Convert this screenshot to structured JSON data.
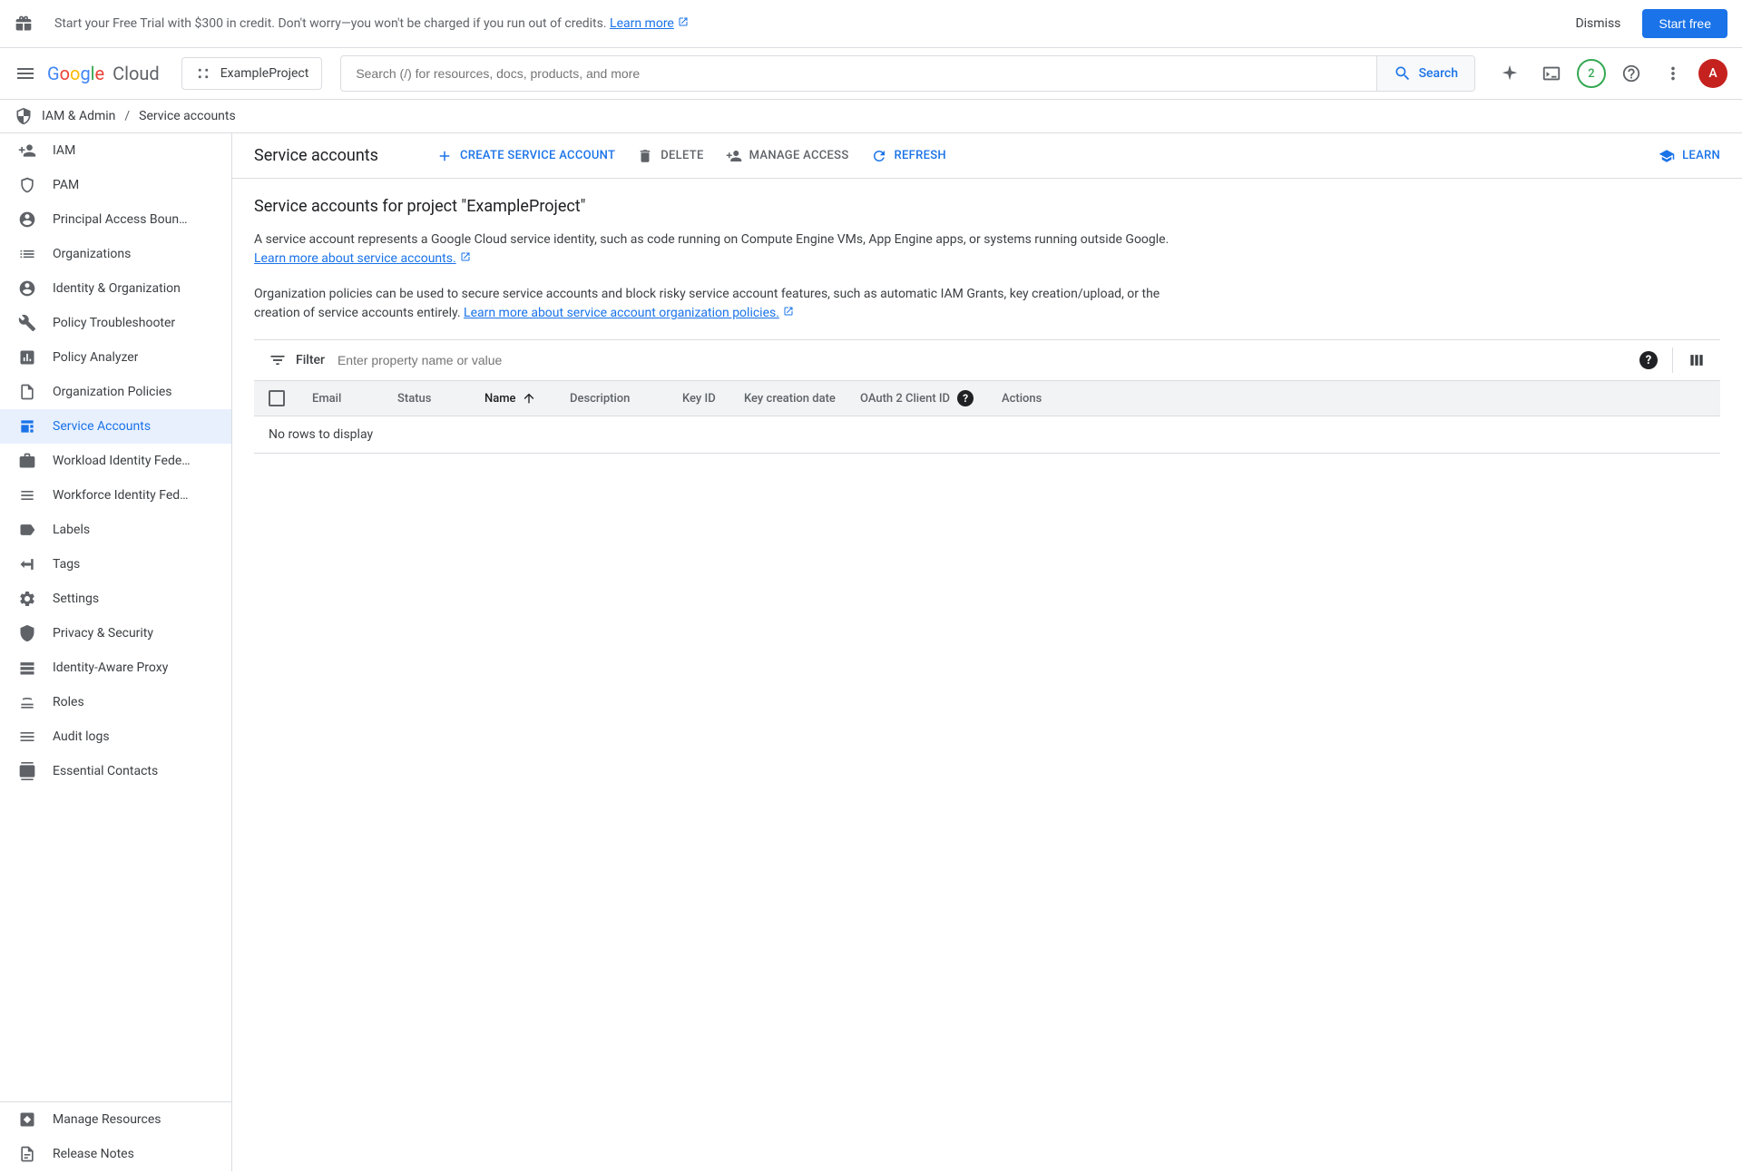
{
  "banner": {
    "text_prefix": "Start your Free Trial with $300 in credit. Don't worry—you won't be charged if you run out of credits. ",
    "link_text": "Learn more",
    "dismiss": "Dismiss",
    "cta": "Start free"
  },
  "header": {
    "project_name": "ExampleProject",
    "search_placeholder": "Search (/) for resources, docs, products, and more",
    "search_button": "Search",
    "trial_badge": "2",
    "avatar_letter": "A"
  },
  "breadcrumb": {
    "section": "IAM & Admin",
    "page": "Service accounts"
  },
  "sidebar": {
    "items": [
      {
        "label": "IAM"
      },
      {
        "label": "PAM"
      },
      {
        "label": "Principal Access Boun…"
      },
      {
        "label": "Organizations"
      },
      {
        "label": "Identity & Organization"
      },
      {
        "label": "Policy Troubleshooter"
      },
      {
        "label": "Policy Analyzer"
      },
      {
        "label": "Organization Policies"
      },
      {
        "label": "Service Accounts"
      },
      {
        "label": "Workload Identity Fede…"
      },
      {
        "label": "Workforce Identity Fed…"
      },
      {
        "label": "Labels"
      },
      {
        "label": "Tags"
      },
      {
        "label": "Settings"
      },
      {
        "label": "Privacy & Security"
      },
      {
        "label": "Identity-Aware Proxy"
      },
      {
        "label": "Roles"
      },
      {
        "label": "Audit logs"
      },
      {
        "label": "Essential Contacts"
      }
    ],
    "footer1": "Manage Resources",
    "footer2": "Release Notes"
  },
  "toolbar": {
    "title": "Service accounts",
    "create": "CREATE SERVICE ACCOUNT",
    "delete": "DELETE",
    "manage": "MANAGE ACCESS",
    "refresh": "REFRESH",
    "learn": "LEARN"
  },
  "content": {
    "heading": "Service accounts for project \"ExampleProject\"",
    "p1_main": "A service account represents a Google Cloud service identity, such as code running on Compute Engine VMs, App Engine apps, or systems running outside Google. ",
    "p1_link": "Learn more about service accounts.",
    "p2_main": "Organization policies can be used to secure service accounts and block risky service account features, such as automatic IAM Grants, key creation/upload, or the creation of service accounts entirely. ",
    "p2_link": "Learn more about service account organization policies."
  },
  "filter": {
    "label": "Filter",
    "placeholder": "Enter property name or value"
  },
  "table": {
    "columns": {
      "email": "Email",
      "status": "Status",
      "name": "Name",
      "description": "Description",
      "key_id": "Key ID",
      "key_creation_date": "Key creation date",
      "oauth_client_id": "OAuth 2 Client ID",
      "actions": "Actions"
    },
    "empty": "No rows to display"
  }
}
